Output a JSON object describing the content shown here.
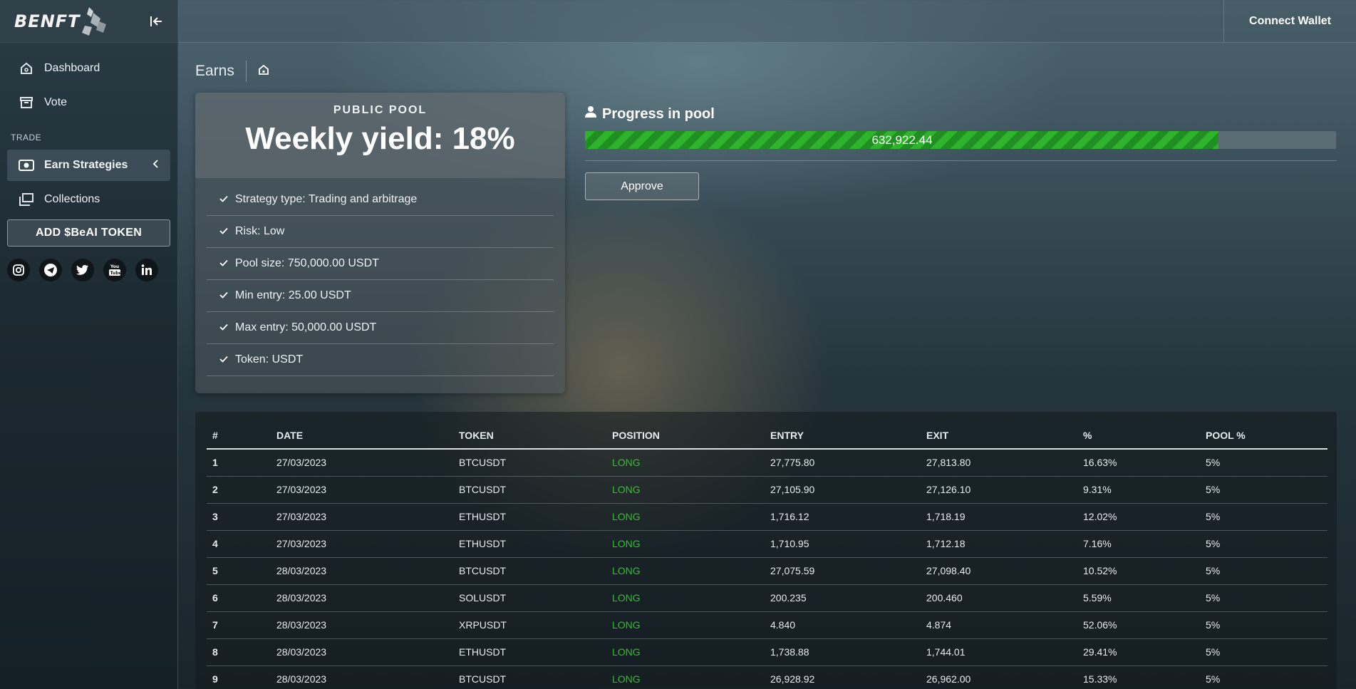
{
  "brand": {
    "logo_text": "BENFT"
  },
  "sidebar": {
    "items": [
      {
        "label": "Dashboard"
      },
      {
        "label": "Vote"
      }
    ],
    "section_label": "TRADE",
    "trade_items": [
      {
        "label": "Earn Strategies"
      },
      {
        "label": "Collections"
      }
    ],
    "add_token_label": "ADD $BeAI TOKEN",
    "socials": [
      "instagram-icon",
      "telegram-icon",
      "twitter-icon",
      "youtube-icon",
      "linkedin-icon"
    ]
  },
  "topbar": {
    "connect_label": "Connect Wallet"
  },
  "breadcrumb": {
    "title": "Earns"
  },
  "pool": {
    "label": "PUBLIC POOL",
    "yield": "Weekly yield: 18%",
    "features": [
      "Strategy type: Trading and arbitrage",
      "Risk: Low",
      "Pool size: 750,000.00 USDT",
      "Min entry: 25.00 USDT",
      "Max entry: 50,000.00 USDT",
      "Token: USDT"
    ]
  },
  "progress": {
    "title": "Progress in pool",
    "value_text": "632,922.44",
    "fraction": 0.8439,
    "approve_label": "Approve"
  },
  "table": {
    "headers": [
      "#",
      "DATE",
      "TOKEN",
      "POSITION",
      "ENTRY",
      "EXIT",
      "%",
      "POOL %"
    ],
    "rows": [
      [
        "1",
        "27/03/2023",
        "BTCUSDT",
        "LONG",
        "27,775.80",
        "27,813.80",
        "16.63%",
        "5%"
      ],
      [
        "2",
        "27/03/2023",
        "BTCUSDT",
        "LONG",
        "27,105.90",
        "27,126.10",
        "9.31%",
        "5%"
      ],
      [
        "3",
        "27/03/2023",
        "ETHUSDT",
        "LONG",
        "1,716.12",
        "1,718.19",
        "12.02%",
        "5%"
      ],
      [
        "4",
        "27/03/2023",
        "ETHUSDT",
        "LONG",
        "1,710.95",
        "1,712.18",
        "7.16%",
        "5%"
      ],
      [
        "5",
        "28/03/2023",
        "BTCUSDT",
        "LONG",
        "27,075.59",
        "27,098.40",
        "10.52%",
        "5%"
      ],
      [
        "6",
        "28/03/2023",
        "SOLUSDT",
        "LONG",
        "200.235",
        "200.460",
        "5.59%",
        "5%"
      ],
      [
        "7",
        "28/03/2023",
        "XRPUSDT",
        "LONG",
        "4.840",
        "4.874",
        "52.06%",
        "5%"
      ],
      [
        "8",
        "28/03/2023",
        "ETHUSDT",
        "LONG",
        "1,738.88",
        "1,744.01",
        "29.41%",
        "5%"
      ],
      [
        "9",
        "28/03/2023",
        "BTCUSDT",
        "LONG",
        "26,928.92",
        "26,962.00",
        "15.33%",
        "5%"
      ]
    ]
  },
  "colors": {
    "long": "#2fc12b",
    "progress_fill": "#2fb32d"
  }
}
